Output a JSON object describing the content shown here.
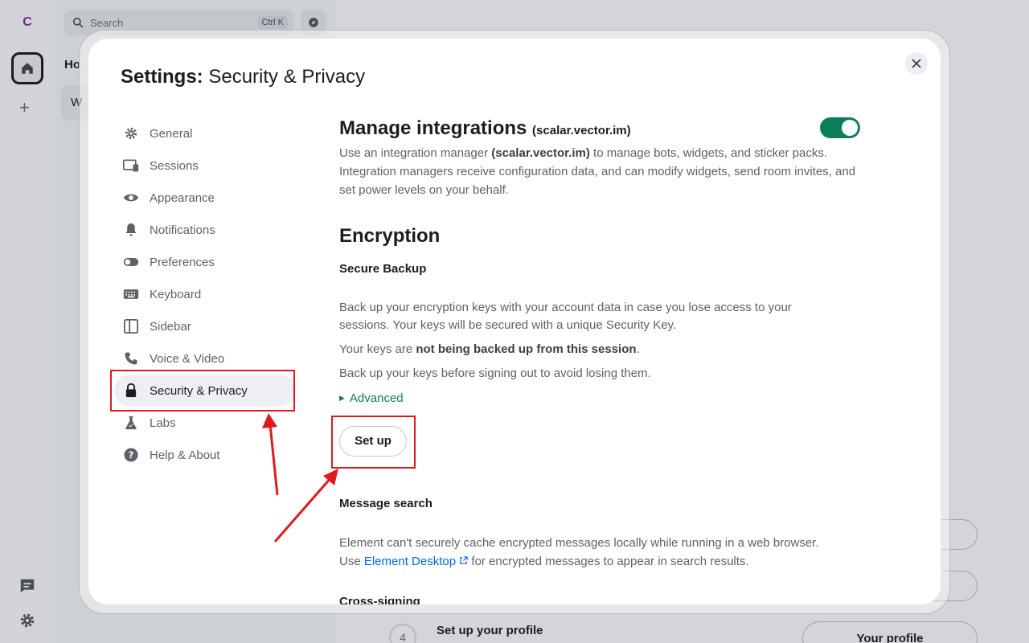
{
  "spaces": {
    "avatar_letter": "C"
  },
  "roomlist": {
    "search_placeholder": "Search",
    "search_shortcut": "Ctrl K",
    "home_title": "Ho",
    "room_initial": "W"
  },
  "background": {
    "step_number": "4",
    "step_title": "Set up your profile",
    "profile_button": "Your profile"
  },
  "dialog": {
    "title_prefix": "Settings:",
    "title_section": "Security & Privacy",
    "close_icon": "close-icon"
  },
  "tabs": [
    {
      "label": "General",
      "icon": "gear-icon"
    },
    {
      "label": "Sessions",
      "icon": "devices-icon"
    },
    {
      "label": "Appearance",
      "icon": "eye-icon"
    },
    {
      "label": "Notifications",
      "icon": "bell-icon"
    },
    {
      "label": "Preferences",
      "icon": "toggle-icon"
    },
    {
      "label": "Keyboard",
      "icon": "keyboard-icon"
    },
    {
      "label": "Sidebar",
      "icon": "sidebar-icon"
    },
    {
      "label": "Voice & Video",
      "icon": "phone-icon"
    },
    {
      "label": "Security & Privacy",
      "icon": "lock-icon",
      "active": true
    },
    {
      "label": "Labs",
      "icon": "flask-icon"
    },
    {
      "label": "Help & About",
      "icon": "help-icon"
    }
  ],
  "integrations": {
    "heading": "Manage integrations",
    "server": "(scalar.vector.im)",
    "toggle_on": true,
    "desc_prefix": "Use an integration manager ",
    "desc_server": "(scalar.vector.im)",
    "desc_suffix": " to manage bots, widgets, and sticker packs. Integration managers receive configuration data, and can modify widgets, send room invites, and set power levels on your behalf."
  },
  "encryption": {
    "heading": "Encryption",
    "backup_heading": "Secure Backup",
    "backup_desc": "Back up your encryption keys with your account data in case you lose access to your sessions. Your keys will be secured with a unique Security Key.",
    "status_prefix": "Your keys are ",
    "status_bold": "not being backed up from this session",
    "status_suffix": ".",
    "warning": "Back up your keys before signing out to avoid losing them.",
    "advanced_label": "Advanced",
    "setup_button": "Set up",
    "msgsearch_heading": "Message search",
    "msgsearch_line1": "Element can't securely cache encrypted messages locally while running in a web browser.",
    "msgsearch_use": "Use ",
    "msgsearch_link": "Element Desktop",
    "msgsearch_line2_suffix": " for encrypted messages to appear in search results.",
    "crosssign_heading": "Cross-signing"
  },
  "colors": {
    "accent": "#0b7f5b",
    "link": "#0467dd",
    "annotation": "#e0191f"
  }
}
